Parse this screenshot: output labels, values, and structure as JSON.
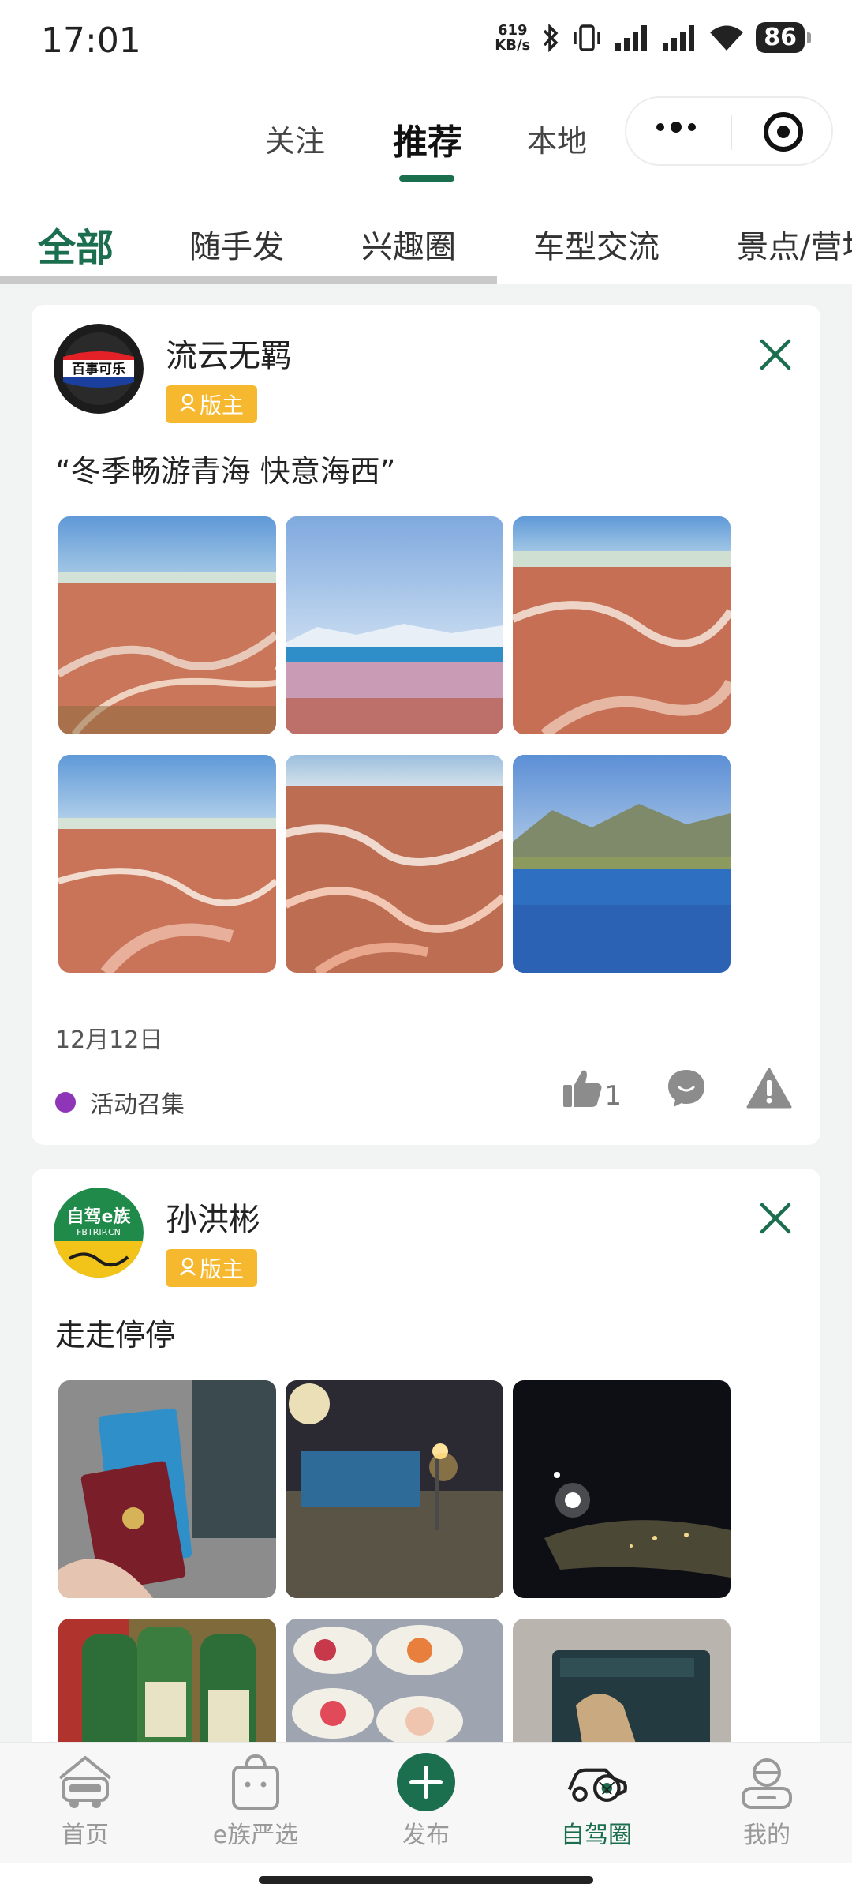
{
  "status": {
    "time": "17:01",
    "net_speed_value": "619",
    "net_speed_unit": "KB/s",
    "battery": "86"
  },
  "top_tabs": [
    "关注",
    "推荐",
    "本地"
  ],
  "categories": [
    "全部",
    "随手发",
    "兴趣圈",
    "车型交流",
    "景点/营地"
  ],
  "posts": [
    {
      "username": "流云无羁",
      "avatar_text": "百事可乐",
      "role": "版主",
      "title": "“冬季畅游青海 快意海西”",
      "date": "12月12日",
      "tag": "活动召集",
      "like_count": "1"
    },
    {
      "username": "孙洪彬",
      "avatar_text": "自驾e族",
      "avatar_subtext": "FBTRIP.CN",
      "role": "版主",
      "title": "走走停停"
    }
  ],
  "bottom_tabs": [
    "首页",
    "e族严选",
    "发布",
    "自驾圈",
    "我的"
  ],
  "colors": {
    "brand_green": "#1b6e4e",
    "badge_yellow": "#f5b82e",
    "tag_purple": "#8f35b8"
  }
}
